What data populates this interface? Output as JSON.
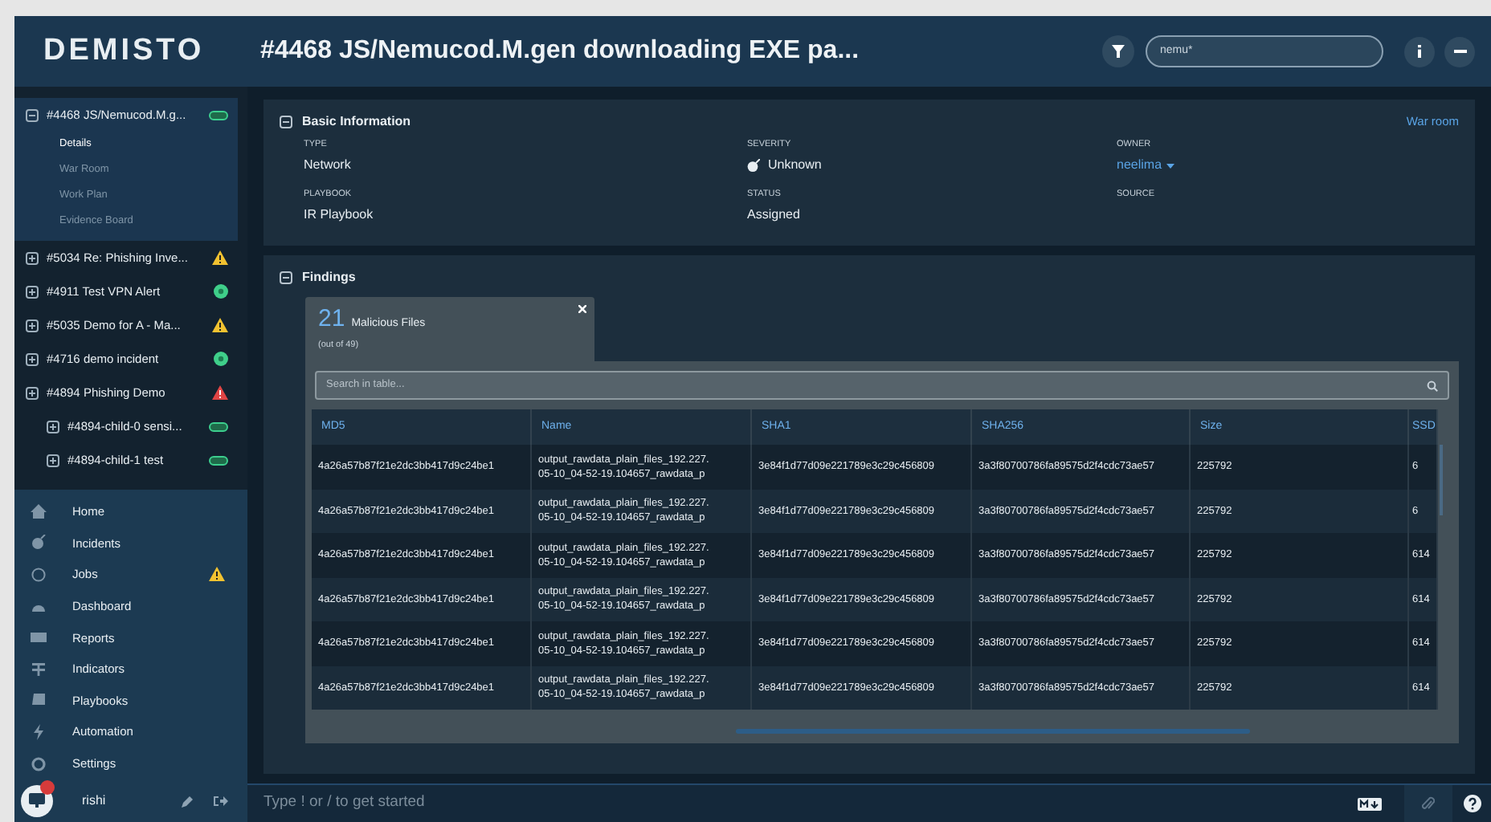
{
  "logo": "DEMISTO",
  "header": {
    "title": "#4468 JS/Nemucod.M.gen downloading EXE pa...",
    "search_value": "nemu*"
  },
  "incidents": [
    {
      "label": "#4468 JS/Nemucod.M.g...",
      "kind": "new",
      "expanded": true,
      "sections": [
        {
          "label": "Details",
          "selected": true
        },
        {
          "label": "War Room",
          "selected": false
        },
        {
          "label": "Work Plan",
          "selected": false
        },
        {
          "label": "Evidence Board",
          "selected": false
        }
      ]
    },
    {
      "label": "#5034 Re: Phishing Inve...",
      "kind": "warning",
      "expanded": false
    },
    {
      "label": "#4911 Test VPN Alert",
      "kind": "green",
      "expanded": false
    },
    {
      "label": "#5035 Demo for A - Ma...",
      "kind": "warning",
      "expanded": false
    },
    {
      "label": "#4716 demo incident",
      "kind": "green",
      "expanded": false
    },
    {
      "label": "#4894 Phishing Demo",
      "kind": "error",
      "expanded": false,
      "children": [
        {
          "label": "#4894-child-0 sensi...",
          "kind": "new",
          "expanded": false
        },
        {
          "label": "#4894-child-1 test",
          "kind": "new",
          "expanded": false
        }
      ]
    }
  ],
  "nav": [
    {
      "label": "Home",
      "warning": false
    },
    {
      "label": "Incidents",
      "warning": false
    },
    {
      "label": "Jobs",
      "warning": true
    },
    {
      "label": "Dashboard",
      "warning": false
    },
    {
      "label": "Reports",
      "warning": false
    },
    {
      "label": "Indicators",
      "warning": false
    },
    {
      "label": "Playbooks",
      "warning": false
    },
    {
      "label": "Automation",
      "warning": false
    },
    {
      "label": "Settings",
      "warning": false
    }
  ],
  "user": {
    "name": "rishi"
  },
  "basic_info": {
    "title": "Basic Information",
    "link": "War room",
    "fields": [
      {
        "label": "TYPE",
        "value": "Network",
        "kind": "text"
      },
      {
        "label": "SEVERITY",
        "value": "Unknown",
        "kind": "severity"
      },
      {
        "label": "OWNER",
        "value": "neelima",
        "kind": "dropdown"
      },
      {
        "label": "PLAYBOOK",
        "value": "IR Playbook",
        "kind": "text"
      },
      {
        "label": "STATUS",
        "value": "Assigned",
        "kind": "text"
      },
      {
        "label": "SOURCE",
        "kind": "empty"
      }
    ]
  },
  "findings": {
    "title": "Findings",
    "card": {
      "count": "21",
      "label": "Malicious Files",
      "sub": "(out of 49)"
    },
    "search_placeholder": "Search in table...",
    "table": {
      "columns": [
        "MD5",
        "Name",
        "SHA1",
        "SHA256",
        "Size",
        "SSD"
      ],
      "rows": [
        [
          "4a26a57b87f21e2dc3bb417d9c24be1",
          [
            "output_rawdata_plain_files_192.227.",
            "05-10_04-52-19.104657_rawdata_p"
          ],
          "3e84f1d77d09e221789e3c29c456809",
          "3a3f80700786fa89575d2f4cdc73ae57",
          "225792",
          "6"
        ],
        [
          "4a26a57b87f21e2dc3bb417d9c24be1",
          [
            "output_rawdata_plain_files_192.227.",
            "05-10_04-52-19.104657_rawdata_p"
          ],
          "3e84f1d77d09e221789e3c29c456809",
          "3a3f80700786fa89575d2f4cdc73ae57",
          "225792",
          "6"
        ],
        [
          "4a26a57b87f21e2dc3bb417d9c24be1",
          [
            "output_rawdata_plain_files_192.227.",
            "05-10_04-52-19.104657_rawdata_p"
          ],
          "3e84f1d77d09e221789e3c29c456809",
          "3a3f80700786fa89575d2f4cdc73ae57",
          "225792",
          "614"
        ],
        [
          "4a26a57b87f21e2dc3bb417d9c24be1",
          [
            "output_rawdata_plain_files_192.227.",
            "05-10_04-52-19.104657_rawdata_p"
          ],
          "3e84f1d77d09e221789e3c29c456809",
          "3a3f80700786fa89575d2f4cdc73ae57",
          "225792",
          "614"
        ],
        [
          "4a26a57b87f21e2dc3bb417d9c24be1",
          [
            "output_rawdata_plain_files_192.227.",
            "05-10_04-52-19.104657_rawdata_p"
          ],
          "3e84f1d77d09e221789e3c29c456809",
          "3a3f80700786fa89575d2f4cdc73ae57",
          "225792",
          "614"
        ],
        [
          "4a26a57b87f21e2dc3bb417d9c24be1",
          [
            "output_rawdata_plain_files_192.227.",
            "05-10_04-52-19.104657_rawdata_p"
          ],
          "3e84f1d77d09e221789e3c29c456809",
          "3a3f80700786fa89575d2f4cdc73ae57",
          "225792",
          "614"
        ]
      ]
    }
  },
  "command": {
    "placeholder": "Type ! or / to get started"
  }
}
